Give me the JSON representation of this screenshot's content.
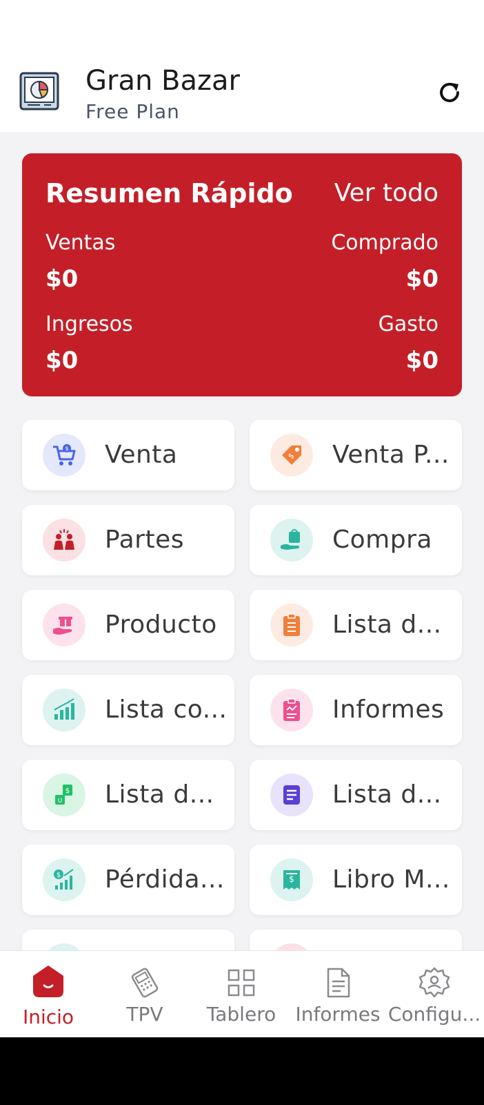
{
  "header": {
    "title": "Gran Bazar",
    "plan": "Free Plan"
  },
  "summary": {
    "title": "Resumen Rápido",
    "view_all": "Ver todo",
    "sales_label": "Ventas",
    "sales_value": "$0",
    "purchased_label": "Comprado",
    "purchased_value": "$0",
    "income_label": "Ingresos",
    "income_value": "$0",
    "expense_label": "Gasto",
    "expense_value": "$0"
  },
  "tiles": [
    {
      "label": "Venta",
      "icon": "cart-icon"
    },
    {
      "label": "Venta P...",
      "icon": "price-tag-icon"
    },
    {
      "label": "Partes",
      "icon": "people-icon"
    },
    {
      "label": "Compra",
      "icon": "shopping-bag-hand-icon"
    },
    {
      "label": "Producto",
      "icon": "gift-hand-icon"
    },
    {
      "label": "Lista d...",
      "icon": "clipboard-icon"
    },
    {
      "label": "Lista co...",
      "icon": "bar-chart-icon"
    },
    {
      "label": "Informes",
      "icon": "report-icon"
    },
    {
      "label": "Lista d...",
      "icon": "money-transfer-icon"
    },
    {
      "label": "Lista d...",
      "icon": "document-icon"
    },
    {
      "label": "Pérdida...",
      "icon": "growth-chart-icon"
    },
    {
      "label": "Libro M...",
      "icon": "receipt-icon"
    }
  ],
  "nav": [
    {
      "label": "Inicio",
      "icon": "home-icon",
      "active": true
    },
    {
      "label": "TPV",
      "icon": "pos-terminal-icon"
    },
    {
      "label": "Tablero",
      "icon": "grid-icon"
    },
    {
      "label": "Informes",
      "icon": "file-icon"
    },
    {
      "label": "Configu...",
      "icon": "settings-icon"
    }
  ],
  "colors": {
    "brand": "#c41f28",
    "background": "#f3f2f4"
  }
}
